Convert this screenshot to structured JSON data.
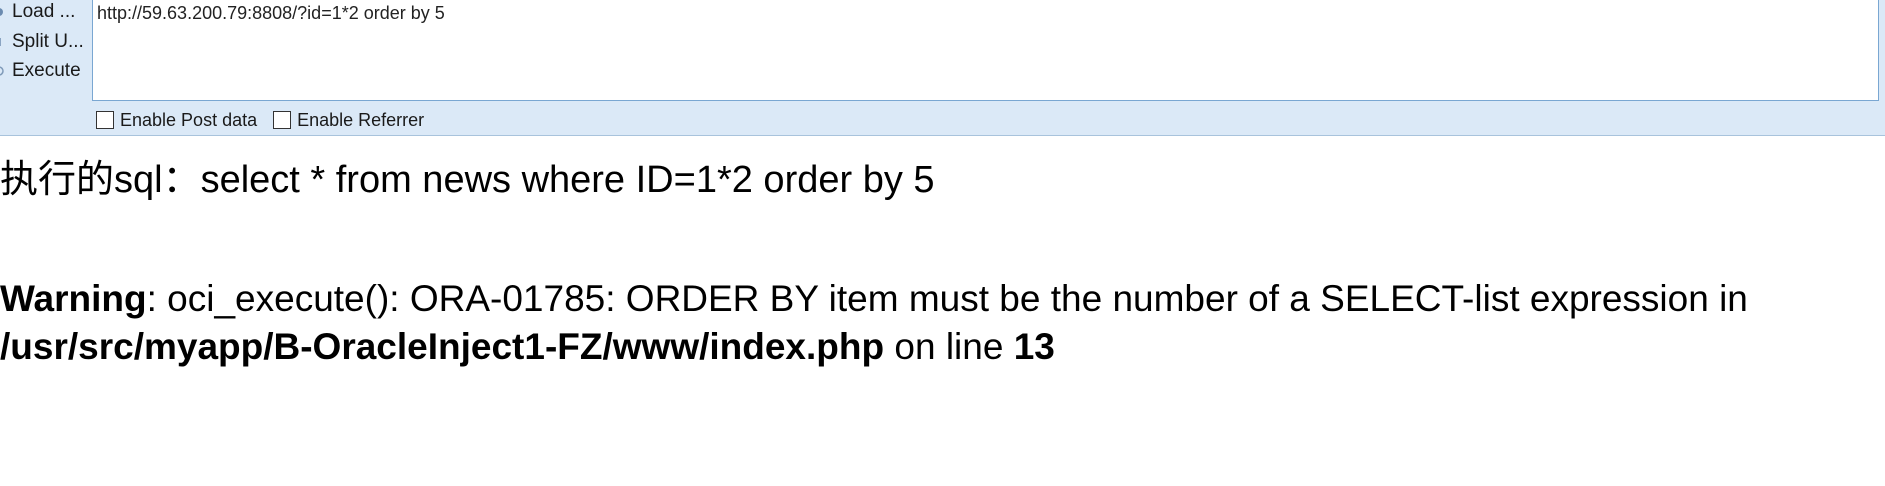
{
  "hackbar": {
    "actions": {
      "load": "Load ...",
      "split": "Split U...",
      "execute": "Execute"
    },
    "url_value": "http://59.63.200.79:8808/?id=1*2 order by 5",
    "options": {
      "post": "Enable Post data",
      "referrer": "Enable Referrer"
    }
  },
  "page": {
    "sql_label": "执行的sql：select * from news where ID=1*2 order by 5",
    "warning": {
      "label": "Warning",
      "message": ": oci_execute(): ORA-01785: ORDER BY item must be the number of a SELECT-list expression in",
      "file": "/usr/src/myapp/B-OracleInject1-FZ/www/index.php",
      "on_line": " on line ",
      "line_number": "13"
    }
  },
  "icons": {
    "load": "load-icon",
    "split": "split-icon",
    "execute": "execute-icon"
  }
}
